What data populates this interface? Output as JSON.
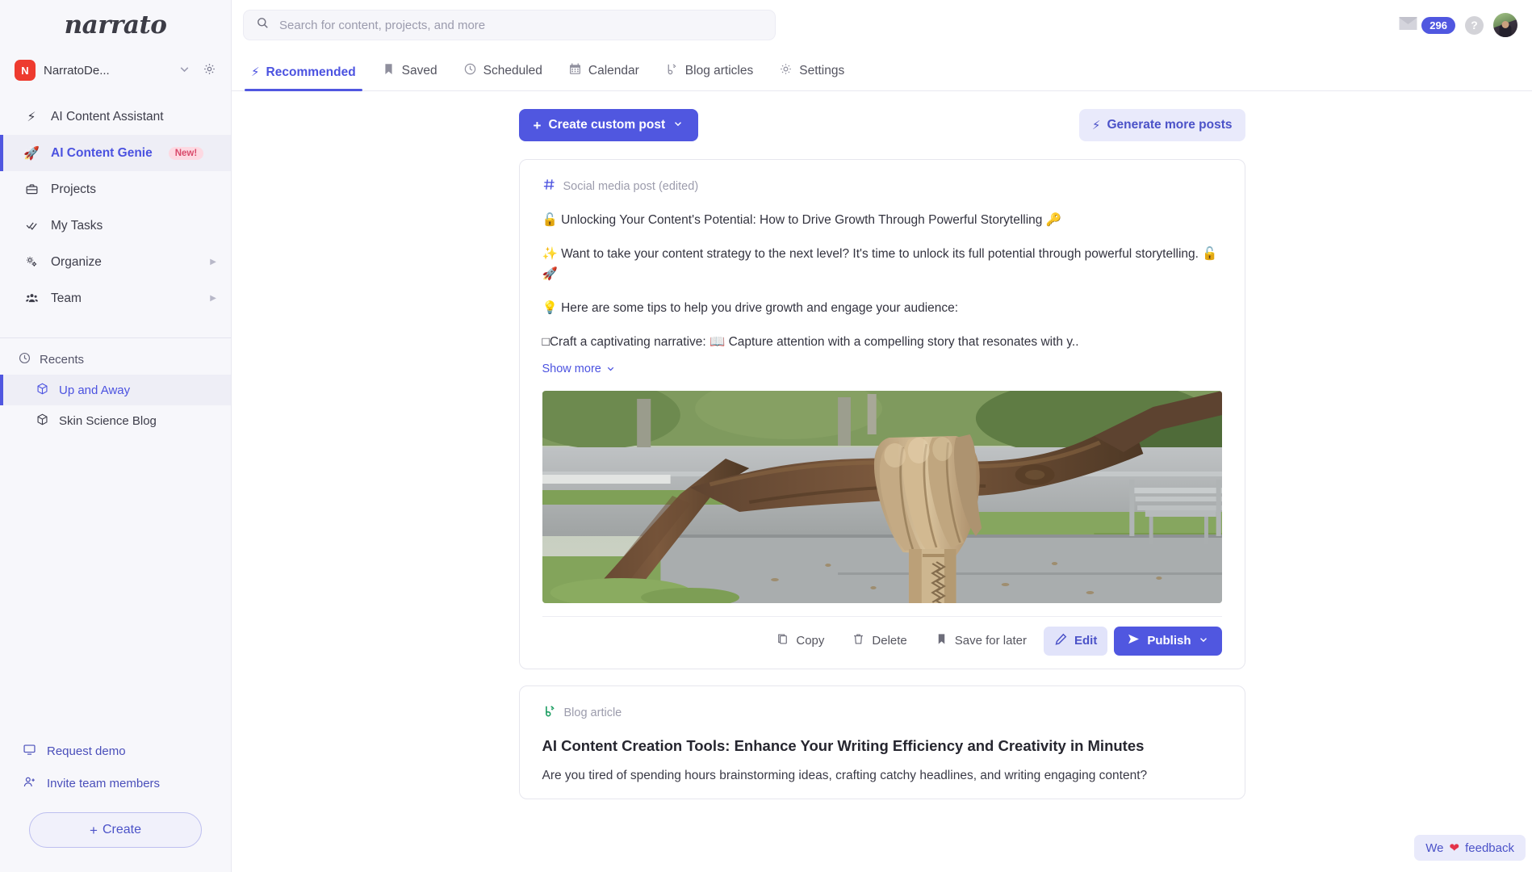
{
  "brand": {
    "logo_text": "narrato"
  },
  "workspace": {
    "initial": "N",
    "name": "NarratoDe...",
    "chevron": "⌄",
    "gear_icon": "gear-icon"
  },
  "sidebar": {
    "items": [
      {
        "label": "AI Content Assistant",
        "icon": "lightning-icon",
        "active": false,
        "badge": "",
        "arrow": false
      },
      {
        "label": "AI Content Genie",
        "icon": "rocket-icon",
        "active": true,
        "badge": "New!",
        "arrow": false
      },
      {
        "label": "Projects",
        "icon": "briefcase-icon",
        "active": false,
        "badge": "",
        "arrow": false
      },
      {
        "label": "My Tasks",
        "icon": "check-icon",
        "active": false,
        "badge": "",
        "arrow": false
      },
      {
        "label": "Organize",
        "icon": "gears-icon",
        "active": false,
        "badge": "",
        "arrow": true
      },
      {
        "label": "Team",
        "icon": "people-icon",
        "active": false,
        "badge": "",
        "arrow": true
      }
    ],
    "recents_label": "Recents",
    "recents": [
      {
        "label": "Up and Away",
        "active": true
      },
      {
        "label": "Skin Science Blog",
        "active": false
      }
    ],
    "bottom_links": [
      {
        "label": "Request demo",
        "icon": "monitor-icon"
      },
      {
        "label": "Invite team members",
        "icon": "user-plus-icon"
      }
    ],
    "create_button": "Create"
  },
  "topbar": {
    "search_placeholder": "Search for content, projects, and more",
    "search_value": "",
    "mail_count": "296",
    "help_label": "?"
  },
  "tabs": [
    {
      "label": "Recommended",
      "icon": "lightning-icon",
      "active": true
    },
    {
      "label": "Saved",
      "icon": "bookmark-icon",
      "active": false
    },
    {
      "label": "Scheduled",
      "icon": "clock-icon",
      "active": false
    },
    {
      "label": "Calendar",
      "icon": "calendar-icon",
      "active": false
    },
    {
      "label": "Blog articles",
      "icon": "blog-icon",
      "active": false
    },
    {
      "label": "Settings",
      "icon": "gear-icon",
      "active": false
    }
  ],
  "actions": {
    "create_custom_post": "Create custom post",
    "generate_more_posts": "Generate more posts"
  },
  "post_card": {
    "type_label": "Social media post (edited)",
    "type_icon": "hash-icon",
    "lines": [
      "🔓 Unlocking Your Content's Potential: How to Drive Growth Through Powerful Storytelling 🔑",
      "✨ Want to take your content strategy to the next level? It's time to unlock its full potential through powerful storytelling. 🔓 🚀",
      "💡 Here are some tips to help you drive growth and engage your audience:",
      "□Craft a captivating narrative: 📖 Capture attention with a compelling story that resonates with y.."
    ],
    "show_more": "Show more",
    "image_alt": "carved wooden hand sculpture supporting a tree branch in a park",
    "buttons": {
      "copy": "Copy",
      "delete": "Delete",
      "save_for_later": "Save for later",
      "edit": "Edit",
      "publish": "Publish"
    }
  },
  "blog_card": {
    "type_label": "Blog article",
    "type_icon": "blog-icon",
    "title": "AI Content Creation Tools: Enhance Your Writing Efficiency and Creativity in Minutes",
    "body": "Are you tired of spending hours brainstorming ideas, crafting catchy headlines, and writing engaging content?"
  },
  "feedback": {
    "prefix": "We",
    "heart": "❤",
    "suffix": "feedback"
  },
  "colors": {
    "accent": "#5057e0",
    "accent_soft": "#e9eafb",
    "brand_red": "#ee3b2f",
    "badge_new_bg": "#fdd9e2",
    "badge_new_text": "#d94a6b",
    "sidebar_bg": "#f7f7fb"
  }
}
